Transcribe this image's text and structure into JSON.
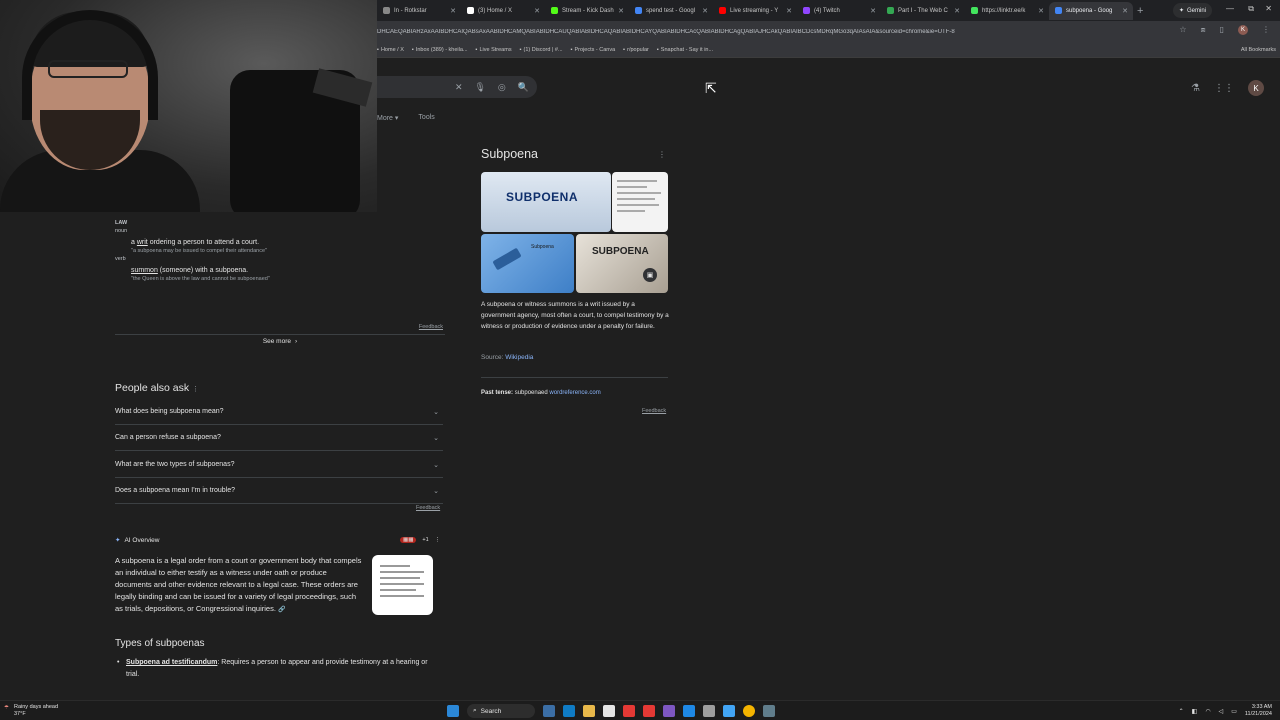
{
  "browser": {
    "tabs": [
      {
        "label": "In - Rotkstar",
        "color": "#888888"
      },
      {
        "label": "(3) Home / X",
        "color": "#ffffff"
      },
      {
        "label": "Stream - Kick Dash",
        "color": "#53fc18"
      },
      {
        "label": "spend test - Googl",
        "color": "#4285f4"
      },
      {
        "label": "Live streaming - Y",
        "color": "#ff0000"
      },
      {
        "label": "(4) Twitch",
        "color": "#9146ff"
      },
      {
        "label": "Part I - The Web C",
        "color": "#34a853"
      },
      {
        "label": "https://linktr.ee/k",
        "color": "#43e55e"
      },
      {
        "label": "subpoena - Goog",
        "color": "#4285f4",
        "active": true
      }
    ],
    "gemini_label": "Gemini",
    "url": "DHCAEQABIARzAxAAIBDHCAIQABsAxAABIDHCAMQABIABIDHCAUQABIABIDHCAQABIABIDHCAYQABIABIDHCAcQABIABIDHCAgQABIAJHCAkQABIAIBCDcsMDRqMGo3qAIAsAIA&sourceid=chrome&ie=UTF-8",
    "bookmarks": [
      "Home / X",
      "Inbox (389) - kheila...",
      "Live Streams",
      "(1) Discord | #...",
      "Projects - Canva",
      "r/popular",
      "Snapchat - Say it in..."
    ],
    "all_bookmarks": "All Bookmarks",
    "profile_initial": "K"
  },
  "search": {
    "filters": [
      "More",
      "Tools"
    ],
    "profile_initial": "K"
  },
  "definition": {
    "pos_noun_group": "LAW",
    "noun": "noun",
    "noun_def_link": "writ",
    "noun_def_pre": "a",
    "noun_def_post": "ordering a person to attend a court.",
    "noun_example": "\"a subpoena may be issued to compel their attendance\"",
    "verb": "verb",
    "verb_def_link": "summon",
    "verb_def_post": "(someone) with a subpoena.",
    "verb_example": "\"the Queen is above the law and cannot be subpoenaed\"",
    "feedback": "Feedback",
    "see_more": "See more"
  },
  "paa": {
    "title": "People also ask",
    "questions": [
      "What does being subpoena mean?",
      "Can a person refuse a subpoena?",
      "What are the two types of subpoenas?",
      "Does a subpoena mean I'm in trouble?"
    ],
    "feedback": "Feedback"
  },
  "ai_overview": {
    "label": "AI Overview",
    "badge_plus": "+1",
    "body": "A subpoena is a legal order from a court or government body that compels an individual to either testify as a witness under oath or produce documents and other evidence relevant to a legal case. These orders are legally binding and can be issued for a variety of legal proceedings, such as trials, depositions, or Congressional inquiries.",
    "types_title": "Types of subpoenas",
    "bullet_term": "Subpoena ad testificandum",
    "bullet_text": ": Requires a person to appear and provide testimony at a hearing or trial."
  },
  "knowledge_panel": {
    "title": "Subpoena",
    "img_text_1": "SUBPOENA",
    "img_text_3": "Subpoena",
    "img_text_4": "SUBPOENA",
    "description": "A subpoena or witness summons is a writ issued by a government agency, most often a court, to compel testimony by a witness or production of evidence under a penalty for failure.",
    "source_label": "Source:",
    "source_link": "Wikipedia",
    "past_tense_label": "Past tense:",
    "past_tense_value": "subpoenaed",
    "past_tense_link": "wordreference.com",
    "feedback": "Feedback"
  },
  "taskbar": {
    "weather_line1": "Rainy days ahead",
    "weather_line2": "37°F",
    "search_label": "Search",
    "time": "3:33 AM",
    "date": "11/21/2024"
  }
}
